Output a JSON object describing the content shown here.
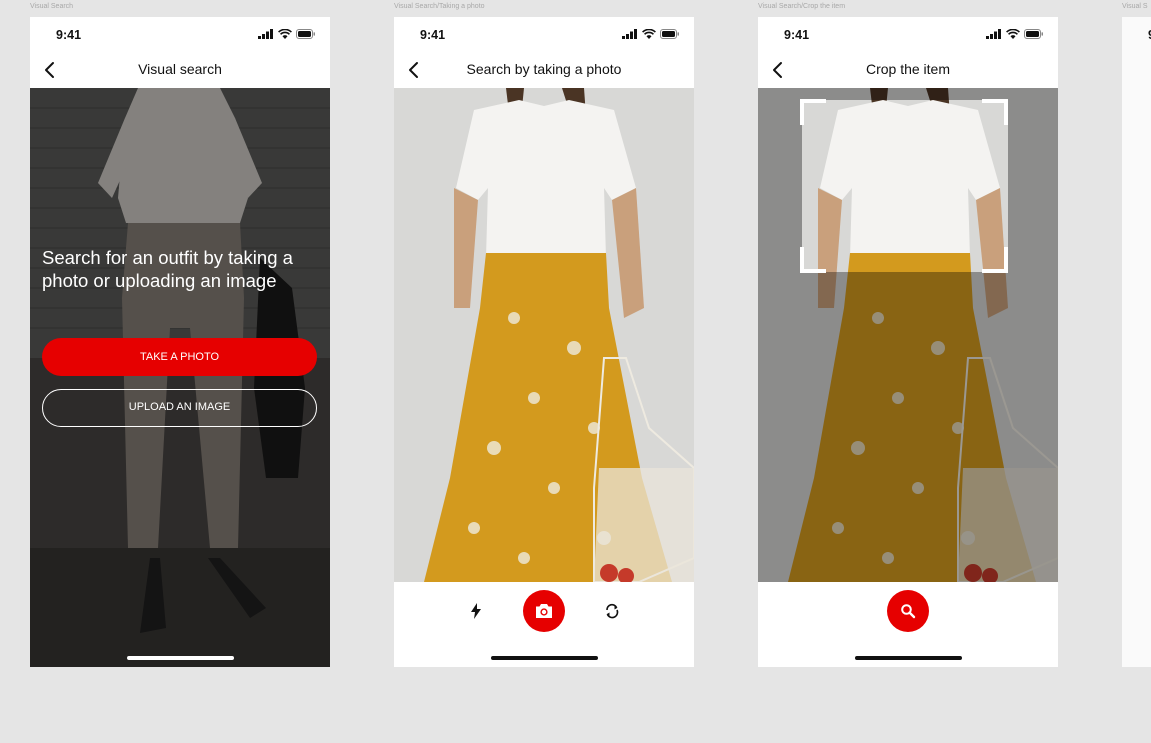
{
  "frames": [
    {
      "label": "Visual Search",
      "status_time": "9:41",
      "title": "Visual search",
      "heading": "Search for an outfit by taking a photo or uploading an image",
      "primary_button": "TAKE A PHOTO",
      "secondary_button": "UPLOAD AN IMAGE"
    },
    {
      "label": "Visual Search/Taking a photo",
      "status_time": "9:41",
      "title": "Search by taking a photo"
    },
    {
      "label": "Visual Search/Crop the item",
      "status_time": "9:41",
      "title": "Crop the item"
    },
    {
      "label": "Visual S",
      "status_time": "9"
    }
  ],
  "icons": {
    "back": "chevron-left-icon",
    "signal": "cellular-signal-icon",
    "wifi": "wifi-icon",
    "battery": "battery-icon",
    "flash": "flash-icon",
    "camera": "camera-icon",
    "switch_camera": "switch-camera-icon",
    "search": "search-icon"
  },
  "colors": {
    "accent": "#e60000",
    "canvas": "#e5e5e5",
    "frame_bg": "#ffffff",
    "text": "#111111"
  }
}
